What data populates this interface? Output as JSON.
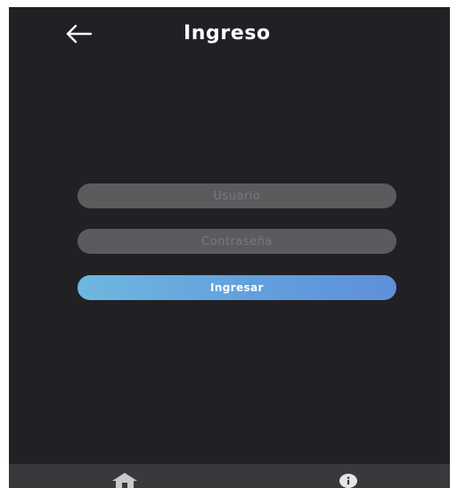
{
  "header": {
    "title": "Ingreso"
  },
  "form": {
    "username_placeholder": "Usuario",
    "password_placeholder": "Contraseña",
    "submit_label": "Ingresar"
  },
  "bottom_nav": {
    "items": [
      {
        "icon": "home-icon"
      },
      {
        "icon": "info-icon"
      }
    ]
  },
  "colors": {
    "background": "#212025",
    "field": "#5b5b5e",
    "button_gradient_start": "#6fb7e0",
    "button_gradient_end": "#5f8fdc",
    "bottom_bar": "#39383d"
  }
}
